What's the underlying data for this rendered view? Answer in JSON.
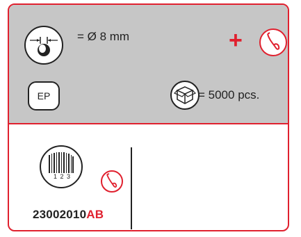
{
  "colors": {
    "accent": "#e0202e",
    "panel_gray": "#c6c6c6",
    "ink": "#222222"
  },
  "top_panel": {
    "diameter_label": "= Ø 8 mm",
    "plus_symbol": "+",
    "ep_label": "EP",
    "quantity_label": "= 5000 pcs.",
    "icons": [
      "tool-diameter-icon",
      "needle-icon",
      "box-icon"
    ]
  },
  "bottom_panel": {
    "barcode_digits": "1 2 3",
    "article_number_main": "23002010",
    "article_number_suffix": "AB",
    "icons": [
      "barcode-icon",
      "needle-icon"
    ]
  }
}
